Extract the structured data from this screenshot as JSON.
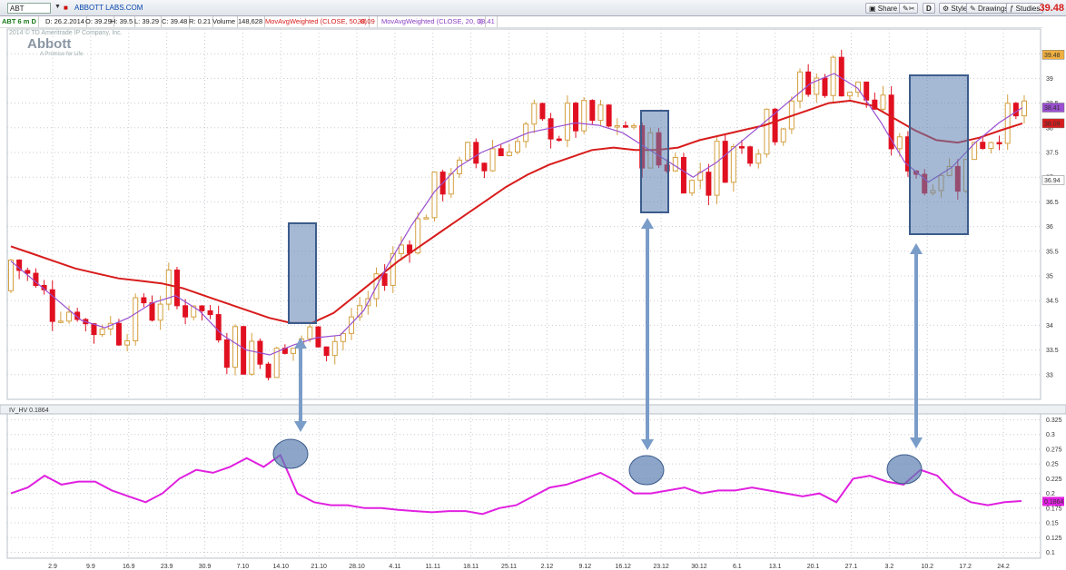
{
  "toolbar": {
    "symbol": "ABT",
    "company": "ABBOTT LABS.COM",
    "buttons": {
      "share": "Share",
      "d": "D",
      "style": "Style",
      "drawings": "Drawings",
      "studies": "Studies"
    },
    "last_price": "39.48"
  },
  "infobar": {
    "period": "ABT 6 m D",
    "date": "D: 26.2.2014",
    "open": "O: 39.29",
    "high": "H: 39.5",
    "low": "L: 39.29",
    "close": "C: 39.48",
    "range": "R: 0.21",
    "volume_label": "Volume",
    "volume": "148,628",
    "ma50": "MovAvgWeighted (CLOSE, 50, 0)",
    "ma50_val": "38.09",
    "ma20": "MovAvgWeighted (CLOSE, 20, 0)",
    "ma20_val": "38.41"
  },
  "watermark": {
    "copyright": "2014 © TD Ameritrade IP Company, Inc.",
    "logo": "Abbott",
    "tagline": "A Promise for Life"
  },
  "indicator": {
    "label": "IV_HV",
    "value": "0.1864"
  },
  "colors": {
    "up": "#f0c060",
    "down": "#e01020",
    "ma50": "#d81c1c",
    "ma20": "#9a4fd0",
    "iv": "#e020e0",
    "highlight": "#5b7fb0"
  },
  "chart_data": [
    {
      "type": "candlestick",
      "title": "",
      "x_ticks": [
        "2.9",
        "9.9",
        "16.9",
        "23.9",
        "30.9",
        "7.10",
        "14.10",
        "21.10",
        "28.10",
        "4.11",
        "11.11",
        "18.11",
        "25.11",
        "2.12",
        "9.12",
        "16.12",
        "23.12",
        "30.12",
        "6.1",
        "13.1",
        "20.1",
        "27.1",
        "3.2",
        "10.2",
        "17.2",
        "24.2"
      ],
      "y_ticks": [
        33,
        33.5,
        34,
        34.5,
        35,
        35.5,
        36,
        36.5,
        37,
        37.5,
        38,
        38.5,
        39,
        39.5
      ],
      "ylim": [
        32.5,
        40
      ],
      "price_labels": {
        "last": "39.48",
        "ma20": "38.41",
        "ma50": "38.09",
        "cursor": "36.94"
      },
      "series": [
        {
          "name": "MovAvgWeighted (CLOSE, 50, 0)",
          "values": [
            35.6,
            35.45,
            35.3,
            35.15,
            35.05,
            34.95,
            34.9,
            34.85,
            34.75,
            34.6,
            34.45,
            34.3,
            34.15,
            34.05,
            34.05,
            34.25,
            34.6,
            34.95,
            35.3,
            35.6,
            35.9,
            36.2,
            36.5,
            36.8,
            37.05,
            37.25,
            37.4,
            37.55,
            37.6,
            37.55,
            37.55,
            37.6,
            37.75,
            37.85,
            37.95,
            38.05,
            38.2,
            38.35,
            38.5,
            38.55,
            38.45,
            38.2,
            37.95,
            37.75,
            37.7,
            37.8,
            37.95,
            38.09
          ]
        },
        {
          "name": "MovAvgWeighted (CLOSE, 20, 0)",
          "values": [
            35.3,
            34.9,
            34.5,
            34.1,
            33.95,
            34.15,
            34.45,
            34.6,
            34.3,
            33.8,
            33.5,
            33.4,
            33.6,
            33.75,
            33.8,
            34.3,
            35.2,
            36.0,
            36.7,
            37.2,
            37.5,
            37.7,
            37.9,
            38.0,
            38.1,
            38.05,
            37.9,
            37.6,
            37.3,
            37.0,
            37.3,
            37.7,
            38.1,
            38.5,
            38.9,
            39.1,
            38.8,
            38.1,
            37.3,
            36.9,
            37.2,
            37.7,
            38.1,
            38.41
          ]
        }
      ]
    },
    {
      "type": "line",
      "title": "",
      "y_ticks": [
        0.1,
        0.125,
        0.15,
        0.175,
        0.2,
        0.225,
        0.25,
        0.275,
        0.3,
        0.325
      ],
      "ylim": [
        0.09,
        0.335
      ],
      "series": [
        {
          "name": "IV_HV",
          "values": [
            0.2,
            0.21,
            0.23,
            0.215,
            0.22,
            0.22,
            0.205,
            0.195,
            0.185,
            0.2,
            0.225,
            0.24,
            0.235,
            0.245,
            0.26,
            0.245,
            0.265,
            0.2,
            0.185,
            0.18,
            0.18,
            0.175,
            0.175,
            0.172,
            0.17,
            0.168,
            0.17,
            0.17,
            0.165,
            0.175,
            0.18,
            0.195,
            0.21,
            0.215,
            0.225,
            0.235,
            0.22,
            0.2,
            0.2,
            0.205,
            0.21,
            0.2,
            0.205,
            0.205,
            0.21,
            0.205,
            0.2,
            0.195,
            0.2,
            0.185,
            0.225,
            0.23,
            0.22,
            0.215,
            0.24,
            0.23,
            0.2,
            0.185,
            0.18,
            0.185,
            0.187
          ]
        }
      ]
    }
  ]
}
